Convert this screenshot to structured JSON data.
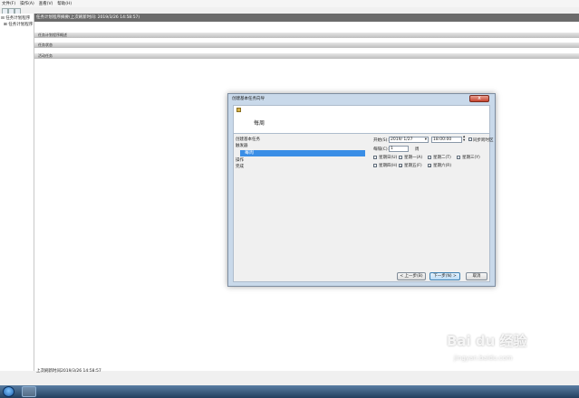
{
  "menubar": [
    "文件(F)",
    "操作(A)",
    "查看(V)",
    "帮助(H)"
  ],
  "tree": {
    "root": "任务计划程序",
    "child": "任务计划程序"
  },
  "main": {
    "header": "任务计划程序摘要(上次刷新时间: 2019/3/26 14:58:57)",
    "sections": [
      "任务计划程序概述",
      "任务状态",
      "活动任务"
    ],
    "last_refresh": "上次刷新时间2019/3/26 14:58:57"
  },
  "wizard": {
    "title": "创建基本任务向导",
    "close": "x",
    "heading": "每周",
    "steps": [
      "创建基本任务",
      "触发器",
      "每周",
      "操作",
      "完成"
    ],
    "start_label": "开始(S):",
    "start_date": "2019/ 1/27",
    "start_time": "18:00:00",
    "sync_tz": "同步跨时区",
    "recur_label": "每隔(C):",
    "recur_value": "1",
    "recur_unit": "周",
    "days": [
      {
        "label": "星期日(U)",
        "checked": false
      },
      {
        "label": "星期一(A)",
        "checked": false
      },
      {
        "label": "星期二(T)",
        "checked": false
      },
      {
        "label": "星期三(Y)",
        "checked": false
      },
      {
        "label": "星期四(H)",
        "checked": false
      },
      {
        "label": "星期五(F)",
        "checked": true
      },
      {
        "label": "星期六(R)",
        "checked": true
      }
    ],
    "checkmark": "✓",
    "back": "< 上一步(B)",
    "next": "下一步(N) >",
    "cancel": "取消"
  },
  "watermark": {
    "logo": "Bai du 经验",
    "sub": "jingyan.baidu.com"
  }
}
